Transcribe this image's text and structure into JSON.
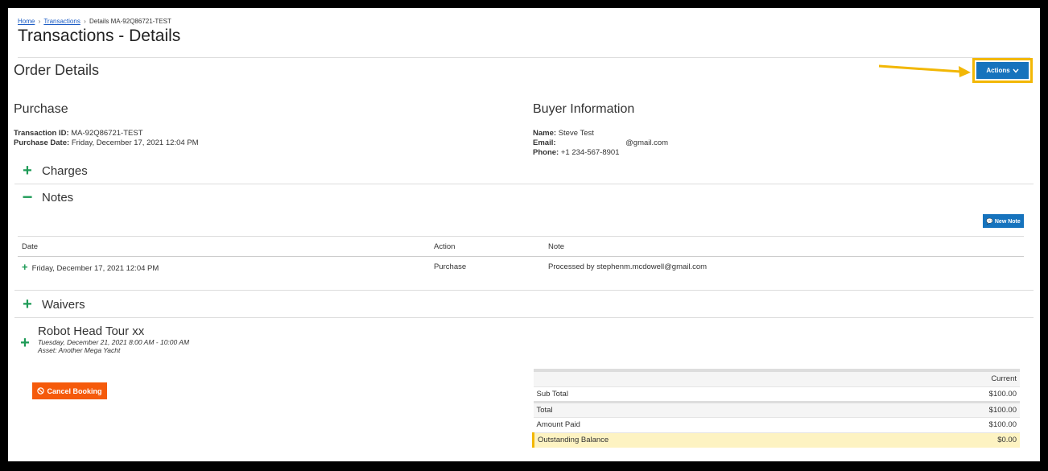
{
  "breadcrumb": {
    "home": "Home",
    "transactions": "Transactions",
    "current": "Details MA-92Q86721-TEST",
    "separator": "›"
  },
  "page_title": "Transactions - Details",
  "order_details": {
    "title": "Order Details",
    "actions_label": "Actions",
    "actions_icon": "chevron-down-icon"
  },
  "purchase": {
    "title": "Purchase",
    "transaction_id_label": "Transaction ID:",
    "transaction_id": "MA-92Q86721-TEST",
    "purchase_date_label": "Purchase Date:",
    "purchase_date": "Friday, December 17, 2021 12:04 PM"
  },
  "buyer": {
    "title": "Buyer Information",
    "name_label": "Name:",
    "name": "Steve Test",
    "email_label": "Email:",
    "email": "@gmail.com",
    "phone_label": "Phone:",
    "phone": "+1 234-567-8901"
  },
  "sections": {
    "charges": "Charges",
    "notes": "Notes",
    "waivers": "Waivers"
  },
  "notes": {
    "new_note_label": "New Note",
    "columns": [
      "Date",
      "Action",
      "Note"
    ],
    "rows": [
      {
        "date": "Friday, December 17, 2021 12:04 PM",
        "action": "Purchase",
        "note": "Processed by stephenm.mcdowell@gmail.com"
      }
    ]
  },
  "booking": {
    "title": "Robot Head Tour xx",
    "datetime": "Tuesday, December 21, 2021 8:00 AM - 10:00 AM",
    "asset": "Asset: Another Mega Yacht",
    "cancel_label": "Cancel Booking"
  },
  "totals": {
    "column_header": "Current",
    "sub_total_label": "Sub Total",
    "sub_total": "$100.00",
    "total_label": "Total",
    "total": "$100.00",
    "amount_paid_label": "Amount Paid",
    "amount_paid": "$100.00",
    "outstanding_label": "Outstanding Balance",
    "outstanding": "$0.00"
  },
  "colors": {
    "primary_button": "#1673bd",
    "cancel_button": "#f55a0b",
    "accent_green": "#1e9b57",
    "highlight_yellow": "#f2b705"
  }
}
